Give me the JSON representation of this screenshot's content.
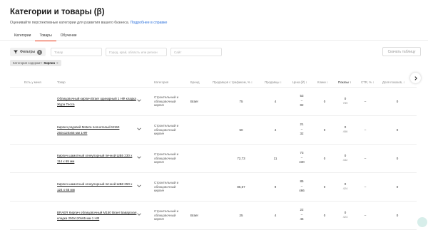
{
  "header": {
    "title": "Категории и товары (β)",
    "subtitle": "Оценивайте перспективные категории для развития вашего бизнеса.",
    "help_link": "Подробнее в справке"
  },
  "tabs": [
    {
      "label": "Категории",
      "active": false
    },
    {
      "label": "Товары",
      "active": true
    },
    {
      "label": "Обучение",
      "active": false
    }
  ],
  "toolbar": {
    "filters_label": "Фильтры",
    "filters_count": "1",
    "product_placeholder": "Товар",
    "region_placeholder": "Город, край, область или регион",
    "site_placeholder": "Сайт",
    "download_label": "Скачать таблицу"
  },
  "chip": {
    "prefix": "Категория содержит:",
    "value": "Кирпич",
    "close": "×"
  },
  "table": {
    "headers": {
      "in_store": "Есть у меня",
      "product": "Товар",
      "category": "Категория",
      "brand": "Бренд",
      "traffic_share": "Продавцов с трафиком, % ↕",
      "sellers": "Продавцы ↕",
      "price": "Цена (₽) ↕",
      "clicks": "Клики ↕",
      "shows": "Показы ↑",
      "ctr": "CTR, % ↕",
      "share": "Доля показов, ↕"
    },
    "rows": [
      {
        "product": "Облицовочный кирпич Braer одинарный 1 НФ кладка Жура Тесса",
        "category": "Строительный и облицовочный кирпич",
        "brand": "Braer",
        "traffic_share": "75",
        "sellers": "4",
        "price_min": "53",
        "price_dash": "–",
        "price_max": "82",
        "clicks": "0",
        "shows": "0",
        "shows_sub": "789",
        "ctr": "–",
        "share": "0"
      },
      {
        "product": "Кирпич рядовой Mstera полнотелый М150 250х120х65 мм 1НФ",
        "category": "Строительный и облицовочный кирпич",
        "brand": "",
        "traffic_share": "50",
        "sellers": "4",
        "price_min": "21",
        "price_dash": "–",
        "price_max": "32",
        "clicks": "0",
        "shows": "0",
        "shows_sub": "456",
        "ctr": "–",
        "share": "0"
      },
      {
        "product": "Кирпич шамотный огнеупорный печной ШБ5 230 х 114 х 65 мм",
        "category": "Строительный и облицовочный кирпич",
        "brand": "",
        "traffic_share": "72,73",
        "sellers": "11",
        "price_min": "73",
        "price_dash": "–",
        "price_max": "430",
        "clicks": "0",
        "shows": "0",
        "shows_sub": "432",
        "ctr": "–",
        "share": "0"
      },
      {
        "product": "Кирпич шамотный огнеупорный печной ШБ8 250 х 124 х 65 мм",
        "category": "Строительный и облицовочный кирпич",
        "brand": "",
        "traffic_share": "86,67",
        "sellers": "9",
        "price_min": "85",
        "price_dash": "–",
        "price_max": "466",
        "clicks": "0",
        "shows": "0",
        "shows_sub": "424",
        "ctr": "–",
        "share": "0"
      },
      {
        "product": "BRAER Кирпич облицовочный М150 Braer Баварская кладка 250х120х65 мм 1 НФ",
        "category": "Строительный и облицовочный кирпич",
        "brand": "Braer",
        "traffic_share": "25",
        "sellers": "4",
        "price_min": "22",
        "price_dash": "–",
        "price_max": "45",
        "clicks": "0",
        "shows": "0",
        "shows_sub": "423",
        "ctr": "–",
        "share": "0"
      }
    ]
  },
  "colors": {
    "accent": "#fc3f1d",
    "link": "#2a6fdb"
  }
}
